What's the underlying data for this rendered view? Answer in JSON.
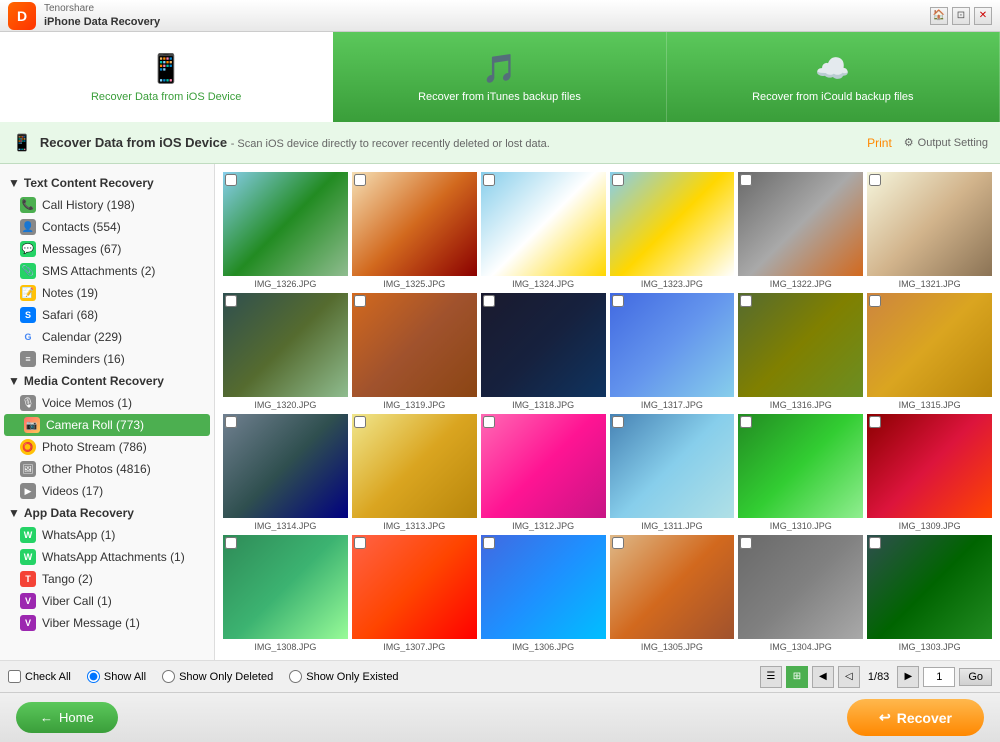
{
  "app": {
    "brand": "Tenorshare",
    "name": "iPhone Data Recovery",
    "logo_letter": "D"
  },
  "titlebar": {
    "controls": [
      "minimize",
      "restore",
      "close"
    ]
  },
  "tabs": [
    {
      "id": "ios",
      "label": "Recover Data from iOS Device",
      "icon": "📱",
      "active": true
    },
    {
      "id": "itunes",
      "label": "Recover from iTunes backup files",
      "icon": "🎵",
      "active": false
    },
    {
      "id": "icloud",
      "label": "Recover from iCould backup files",
      "icon": "☁️",
      "active": false
    }
  ],
  "header": {
    "title": "Recover Data from iOS Device",
    "description": "- Scan iOS device directly to recover recently deleted or lost data.",
    "print_label": "Print",
    "settings_label": "Output Setting"
  },
  "sidebar": {
    "sections": [
      {
        "id": "text-content",
        "label": "Text Content Recovery",
        "items": [
          {
            "id": "call-history",
            "label": "Call History (198)",
            "icon": "📞",
            "icon_class": "icon-green"
          },
          {
            "id": "contacts",
            "label": "Contacts (554)",
            "icon": "👤",
            "icon_class": "icon-gray"
          },
          {
            "id": "messages",
            "label": "Messages (67)",
            "icon": "💬",
            "icon_class": "icon-green2"
          },
          {
            "id": "sms-attachments",
            "label": "SMS Attachments (2)",
            "icon": "📎",
            "icon_class": "icon-green2"
          },
          {
            "id": "notes",
            "label": "Notes (19)",
            "icon": "📝",
            "icon_class": "icon-yellow"
          },
          {
            "id": "safari",
            "label": "Safari (68)",
            "icon": "S",
            "icon_class": "icon-safari"
          },
          {
            "id": "calendar",
            "label": "Calendar (229)",
            "icon": "G",
            "icon_class": "icon-google"
          },
          {
            "id": "reminders",
            "label": "Reminders (16)",
            "icon": "≡",
            "icon_class": "icon-gray"
          }
        ]
      },
      {
        "id": "media-content",
        "label": "Media Content Recovery",
        "items": [
          {
            "id": "voice-memos",
            "label": "Voice Memos (1)",
            "icon": "🎙",
            "icon_class": "icon-gray"
          },
          {
            "id": "camera-roll",
            "label": "Camera Roll (773)",
            "icon": "📷",
            "icon_class": "icon-camera",
            "active": true
          },
          {
            "id": "photo-stream",
            "label": "Photo Stream (786)",
            "icon": "⭕",
            "icon_class": "icon-yellow"
          },
          {
            "id": "other-photos",
            "label": "Other Photos (4816)",
            "icon": "🖼",
            "icon_class": "icon-gray"
          },
          {
            "id": "videos",
            "label": "Videos (17)",
            "icon": "▶",
            "icon_class": "icon-gray"
          }
        ]
      },
      {
        "id": "app-data",
        "label": "App Data Recovery",
        "items": [
          {
            "id": "whatsapp",
            "label": "WhatsApp (1)",
            "icon": "W",
            "icon_class": "icon-green2"
          },
          {
            "id": "whatsapp-attachments",
            "label": "WhatsApp Attachments (1)",
            "icon": "W",
            "icon_class": "icon-green2"
          },
          {
            "id": "tango",
            "label": "Tango (2)",
            "icon": "T",
            "icon_class": "icon-red"
          },
          {
            "id": "viber-call",
            "label": "Viber Call (1)",
            "icon": "V",
            "icon_class": "icon-purple"
          },
          {
            "id": "viber-message",
            "label": "Viber Message (1)",
            "icon": "V",
            "icon_class": "icon-purple"
          }
        ]
      }
    ]
  },
  "photos": [
    {
      "name": "IMG_1326.JPG",
      "color": "p1"
    },
    {
      "name": "IMG_1325.JPG",
      "color": "p2"
    },
    {
      "name": "IMG_1324.JPG",
      "color": "p3"
    },
    {
      "name": "IMG_1323.JPG",
      "color": "p4"
    },
    {
      "name": "IMG_1322.JPG",
      "color": "p5"
    },
    {
      "name": "IMG_1321.JPG",
      "color": "p6"
    },
    {
      "name": "IMG_1320.JPG",
      "color": "p7"
    },
    {
      "name": "IMG_1319.JPG",
      "color": "p8"
    },
    {
      "name": "IMG_1318.JPG",
      "color": "p9"
    },
    {
      "name": "IMG_1317.JPG",
      "color": "p10"
    },
    {
      "name": "IMG_1316.JPG",
      "color": "p11"
    },
    {
      "name": "IMG_1315.JPG",
      "color": "p12"
    },
    {
      "name": "IMG_1314.JPG",
      "color": "p13"
    },
    {
      "name": "IMG_1313.JPG",
      "color": "p14"
    },
    {
      "name": "IMG_1312.JPG",
      "color": "p15"
    },
    {
      "name": "IMG_1311.JPG",
      "color": "p16"
    },
    {
      "name": "IMG_1310.JPG",
      "color": "p17"
    },
    {
      "name": "IMG_1309.JPG",
      "color": "p18"
    },
    {
      "name": "IMG_1308.JPG",
      "color": "p19"
    },
    {
      "name": "IMG_1307.JPG",
      "color": "p20"
    },
    {
      "name": "IMG_1306.JPG",
      "color": "p21"
    },
    {
      "name": "IMG_1305.JPG",
      "color": "p22"
    },
    {
      "name": "IMG_1304.JPG",
      "color": "p23"
    },
    {
      "name": "IMG_1303.JPG",
      "color": "p24"
    }
  ],
  "bottom_toolbar": {
    "check_all": "Check All",
    "show_all": "Show All",
    "show_only_deleted": "Show Only Deleted",
    "show_only_existed": "Show Only Existed",
    "page_info": "1/83",
    "page_number": "1"
  },
  "footer": {
    "home_label": "Home",
    "recover_label": "Recover"
  }
}
